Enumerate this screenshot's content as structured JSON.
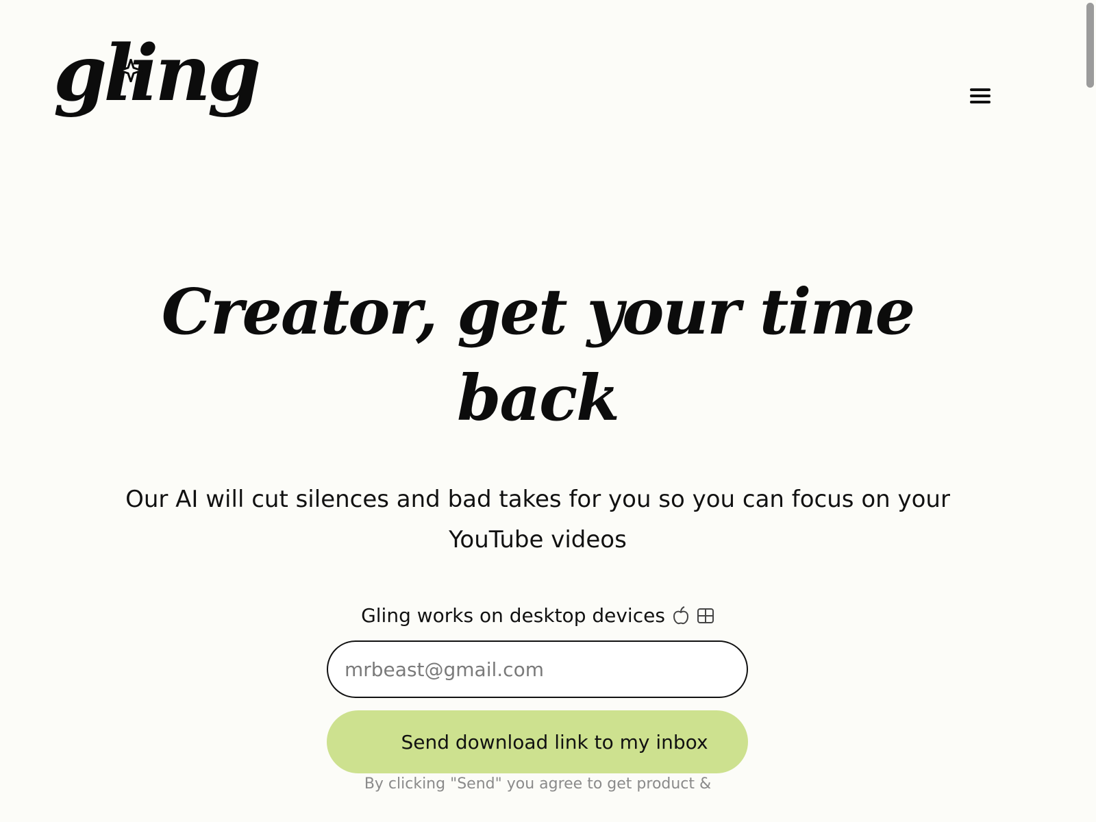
{
  "header": {
    "logo_text": "gling",
    "logo_sparkle_icon": "sparkle-icon",
    "menu_icon": "hamburger-menu-icon"
  },
  "hero": {
    "title": "Creator, get your time back",
    "subtitle": "Our AI will cut silences and bad takes for you so you can focus on your YouTube videos"
  },
  "signup": {
    "desktop_note": "Gling works on desktop devices",
    "platform_icons": [
      "apple-icon",
      "windows-icon"
    ],
    "email_placeholder": "mrbeast@gmail.com",
    "send_button_label": "Send download link to my inbox",
    "consent_text": "By clicking \"Send\" you agree to get product &"
  },
  "colors": {
    "background": "#fcfcf8",
    "text": "#111111",
    "button_bg": "#cde18f",
    "muted_text": "#8a8a8a"
  }
}
